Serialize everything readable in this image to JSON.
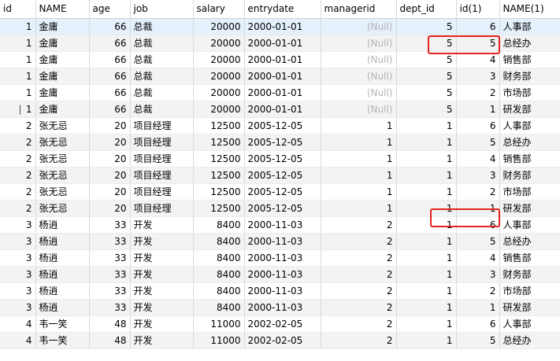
{
  "columns": [
    "id",
    "NAME",
    "age",
    "job",
    "salary",
    "entrydate",
    "managerid",
    "dept_id",
    "id(1)",
    "NAME(1)"
  ],
  "null_label": "(Null)",
  "rows": [
    [
      "1",
      "金庸",
      "66",
      "总裁",
      "20000",
      "2000-01-01",
      "(Null)",
      "5",
      "6",
      "人事部"
    ],
    [
      "1",
      "金庸",
      "66",
      "总裁",
      "20000",
      "2000-01-01",
      "(Null)",
      "5",
      "5",
      "总经办"
    ],
    [
      "1",
      "金庸",
      "66",
      "总裁",
      "20000",
      "2000-01-01",
      "(Null)",
      "5",
      "4",
      "销售部"
    ],
    [
      "1",
      "金庸",
      "66",
      "总裁",
      "20000",
      "2000-01-01",
      "(Null)",
      "5",
      "3",
      "财务部"
    ],
    [
      "1",
      "金庸",
      "66",
      "总裁",
      "20000",
      "2000-01-01",
      "(Null)",
      "5",
      "2",
      "市场部"
    ],
    [
      "1",
      "金庸",
      "66",
      "总裁",
      "20000",
      "2000-01-01",
      "(Null)",
      "5",
      "1",
      "研发部"
    ],
    [
      "2",
      "张无忌",
      "20",
      "项目经理",
      "12500",
      "2005-12-05",
      "1",
      "1",
      "6",
      "人事部"
    ],
    [
      "2",
      "张无忌",
      "20",
      "项目经理",
      "12500",
      "2005-12-05",
      "1",
      "1",
      "5",
      "总经办"
    ],
    [
      "2",
      "张无忌",
      "20",
      "项目经理",
      "12500",
      "2005-12-05",
      "1",
      "1",
      "4",
      "销售部"
    ],
    [
      "2",
      "张无忌",
      "20",
      "项目经理",
      "12500",
      "2005-12-05",
      "1",
      "1",
      "3",
      "财务部"
    ],
    [
      "2",
      "张无忌",
      "20",
      "项目经理",
      "12500",
      "2005-12-05",
      "1",
      "1",
      "2",
      "市场部"
    ],
    [
      "2",
      "张无忌",
      "20",
      "项目经理",
      "12500",
      "2005-12-05",
      "1",
      "1",
      "1",
      "研发部"
    ],
    [
      "3",
      "杨逍",
      "33",
      "开发",
      "8400",
      "2000-11-03",
      "2",
      "1",
      "6",
      "人事部"
    ],
    [
      "3",
      "杨逍",
      "33",
      "开发",
      "8400",
      "2000-11-03",
      "2",
      "1",
      "5",
      "总经办"
    ],
    [
      "3",
      "杨逍",
      "33",
      "开发",
      "8400",
      "2000-11-03",
      "2",
      "1",
      "4",
      "销售部"
    ],
    [
      "3",
      "杨逍",
      "33",
      "开发",
      "8400",
      "2000-11-03",
      "2",
      "1",
      "3",
      "财务部"
    ],
    [
      "3",
      "杨逍",
      "33",
      "开发",
      "8400",
      "2000-11-03",
      "2",
      "1",
      "2",
      "市场部"
    ],
    [
      "3",
      "杨逍",
      "33",
      "开发",
      "8400",
      "2000-11-03",
      "2",
      "1",
      "1",
      "研发部"
    ],
    [
      "4",
      "韦一笑",
      "48",
      "开发",
      "11000",
      "2002-02-05",
      "2",
      "1",
      "6",
      "人事部"
    ],
    [
      "4",
      "韦一笑",
      "48",
      "开发",
      "11000",
      "2002-02-05",
      "2",
      "1",
      "5",
      "总经办"
    ]
  ],
  "selected_row_index": 0,
  "marked_row_index": 5,
  "highlight_color": "#e4231f"
}
